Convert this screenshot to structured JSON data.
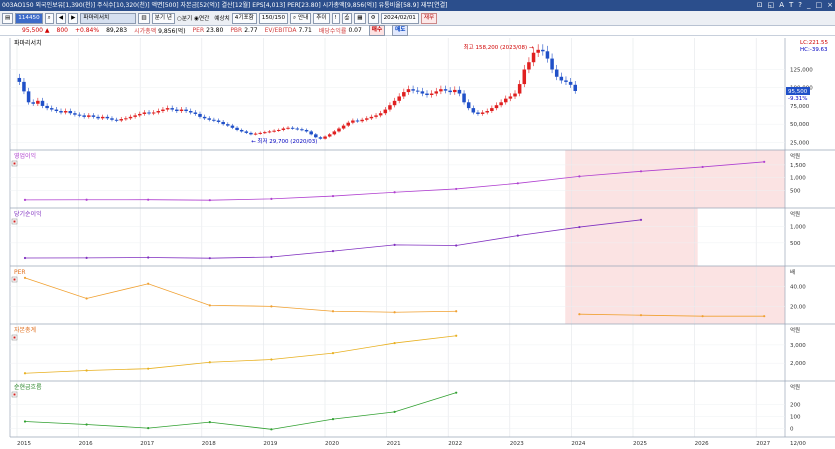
{
  "window": {
    "title": "003460 유화증권 | 유화증권 1,390(천) 주식수[10,320(천)] 액면[500] 자본금[52(억)] 결산[12월] EPS[4,013] PER[23.80] 시가총액[9,856(억)] 유통비율[58.9] 재무[연결]",
    "title_display": "003AO150 외국인보유[1,390(천)] 주식수[10,320(천)] 액면[500] 자본금[52(억)] 결산[12월] EPS[4,013] PER[23.80] 시가총액[9,856(억)] 유통비율[58.9] 재무[연결]",
    "controls": [
      "⊡",
      "◱",
      "A",
      "T",
      "?",
      "_",
      "□",
      "×"
    ]
  },
  "toolbar": {
    "code": "114450",
    "name": "파마리서치",
    "period_btn": "분기 년",
    "radio1": "분기",
    "radio2": "연간",
    "predict_label": "예상치",
    "combine_select": "4기포함",
    "count": "150/150",
    "search_btn": "안내",
    "ratio_btn": "추이",
    "date": "2024/02/01",
    "finance_btn": "재무"
  },
  "infobar": {
    "price": "95,500 ▲",
    "change": "800",
    "rate": "+0.84%",
    "volume": "89,283",
    "mcap_label": "시가총액",
    "mcap": "9,856(억)",
    "per_label": "PER",
    "per": "23.80",
    "pbr_label": "PBR",
    "pbr": "2.77",
    "ev_label": "EV/EBITDA",
    "ev": "7.71",
    "div_label": "배당수익률",
    "div": "0.07",
    "buy": "매수",
    "sell": "매도"
  },
  "chart": {
    "price_title": "파마리서치",
    "top_right_1": "LC:221.55",
    "top_right_2": "HC:-39.63",
    "max_label": "최고 158,200 (2023/08)",
    "min_label": "최저 29,700 (2020/03)",
    "cur_price": "95,500",
    "cur_rate": "-9.31%",
    "price_ticks": [
      "125,000",
      "100,000",
      "75,000",
      "50,000",
      "25,000"
    ],
    "panels": [
      {
        "title": "영업이익",
        "unit": "억원",
        "ticks": [
          "1,500",
          "1,000",
          "500"
        ]
      },
      {
        "title": "당기순이익",
        "unit": "억원",
        "ticks": [
          "1,000",
          "500"
        ]
      },
      {
        "title": "PER",
        "unit": "배",
        "ticks": [
          "40.00",
          "20.00"
        ]
      },
      {
        "title": "자본총계",
        "unit": "억원",
        "ticks": [
          "3,000",
          "2,000"
        ]
      },
      {
        "title": "순현금흐름",
        "unit": "억원",
        "ticks": [
          "200",
          "100",
          "0"
        ]
      }
    ],
    "x_axis": [
      "2015",
      "2016",
      "2017",
      "2018",
      "2019",
      "2020",
      "2021",
      "2022",
      "2023",
      "2024",
      "2025",
      "2026",
      "2027",
      "12/00"
    ]
  },
  "chart_data": {
    "type": "line",
    "x_years": [
      2015,
      2016,
      2017,
      2018,
      2019,
      2020,
      2021,
      2022,
      2023,
      2024,
      2025,
      2026,
      2027
    ],
    "price_range": [
      20000,
      160000
    ],
    "price_close_monthly": [
      108000,
      95000,
      80000,
      78000,
      82000,
      75000,
      72000,
      70000,
      68000,
      66000,
      68000,
      65000,
      63000,
      62000,
      60000,
      62000,
      60000,
      58000,
      60000,
      58000,
      56000,
      55000,
      57000,
      58000,
      60000,
      62000,
      64000,
      66000,
      65000,
      66000,
      68000,
      70000,
      72000,
      70000,
      68000,
      70000,
      68000,
      66000,
      64000,
      60000,
      58000,
      56000,
      55000,
      53000,
      50000,
      48000,
      45000,
      42000,
      40000,
      38000,
      36000,
      37000,
      38000,
      39000,
      40000,
      41000,
      42000,
      44000,
      45000,
      44000,
      43000,
      42000,
      40000,
      36000,
      32000,
      30000,
      33000,
      36000,
      40000,
      44000,
      48000,
      52000,
      55000,
      54000,
      56000,
      58000,
      60000,
      62000,
      65000,
      70000,
      76000,
      82000,
      88000,
      94000,
      98000,
      96000,
      95000,
      92000,
      90000,
      92000,
      95000,
      98000,
      96000,
      94000,
      97000,
      92000,
      80000,
      72000,
      66000,
      64000,
      66000,
      68000,
      72000,
      76000,
      80000,
      85000,
      88000,
      92000,
      105000,
      125000,
      135000,
      148000,
      152000,
      150000,
      140000,
      125000,
      115000,
      110000,
      108000,
      104000,
      95500
    ],
    "series": [
      {
        "name": "영업이익",
        "years": [
          2015,
          2016,
          2017,
          2018,
          2019,
          2020,
          2021,
          2022,
          2023,
          2024,
          2025,
          2026,
          2027
        ],
        "values": [
          130,
          135,
          138,
          120,
          170,
          280,
          430,
          560,
          780,
          1050,
          1250,
          1420,
          1620
        ],
        "estimate_from": 2024
      },
      {
        "name": "당기순이익",
        "years": [
          2015,
          2016,
          2017,
          2018,
          2019,
          2020,
          2021,
          2022,
          2023,
          2024,
          2025
        ],
        "values": [
          40,
          45,
          55,
          35,
          70,
          250,
          440,
          420,
          720,
          980,
          1200
        ],
        "estimate_from": 2024
      },
      {
        "name": "PER",
        "years": [
          2015,
          2016,
          2017,
          2018,
          2019,
          2020,
          2021,
          2022,
          2024,
          2025,
          2026,
          2027
        ],
        "values": [
          49,
          28,
          43,
          21,
          20,
          15,
          14,
          15,
          12,
          11,
          10,
          10
        ],
        "estimate_from": 2024
      },
      {
        "name": "자본총계",
        "years": [
          2015,
          2016,
          2017,
          2018,
          2019,
          2020,
          2021,
          2022
        ],
        "values": [
          1450,
          1600,
          1700,
          2050,
          2200,
          2550,
          3100,
          3500
        ]
      },
      {
        "name": "순현금흐름",
        "years": [
          2015,
          2016,
          2017,
          2018,
          2019,
          2020,
          2021,
          2022
        ],
        "values": [
          60,
          35,
          5,
          55,
          -5,
          80,
          140,
          300
        ]
      }
    ]
  },
  "colors": {
    "title_bar": "#2b4e8c",
    "up_candle": "#e02020",
    "down_candle": "#2050c8",
    "op_profit": "#b040d0",
    "net_income": "#8030c0",
    "per": "#f0a030",
    "equity": "#e8b020",
    "cashflow": "#30a030",
    "estimate_bg": "#fbe3e3"
  }
}
